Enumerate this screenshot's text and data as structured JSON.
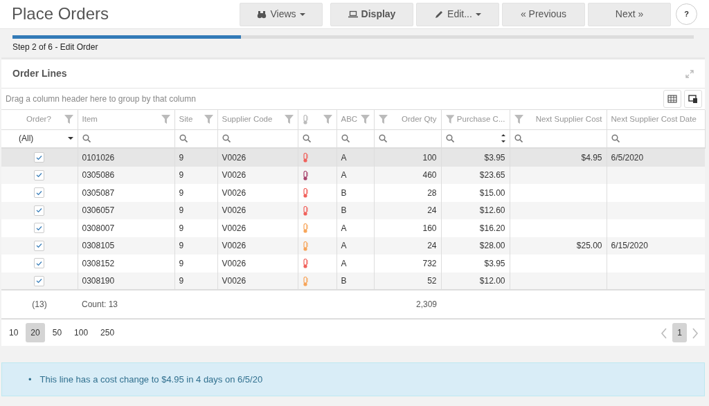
{
  "page_title": "Place Orders",
  "toolbar": [
    {
      "kind": "views",
      "label": "Views",
      "caret": true,
      "bold": false
    },
    {
      "kind": "display",
      "label": "Display",
      "caret": false,
      "bold": true
    },
    {
      "kind": "edit",
      "label": "Edit...",
      "caret": true,
      "bold": false
    },
    {
      "kind": "prev",
      "label": "« Previous",
      "caret": false,
      "bold": false
    },
    {
      "kind": "next",
      "label": "Next »",
      "caret": false,
      "bold": false
    },
    {
      "kind": "help",
      "label": "?",
      "caret": false,
      "bold": true
    }
  ],
  "progress": {
    "level": 0.335,
    "label": "Step 2 of 6 - Edit Order"
  },
  "card": {
    "title": "Order Lines",
    "group_hint": "Drag a column header here to group by that column"
  },
  "columns": [
    {
      "kind": "check",
      "label": "Order?",
      "filter_icon": true,
      "filter_value": "(All)"
    },
    {
      "kind": "text",
      "label": "Item",
      "filter_icon": true
    },
    {
      "kind": "text",
      "label": "Site",
      "filter_icon": true
    },
    {
      "kind": "text",
      "label": "Supplier Code",
      "filter_icon": true
    },
    {
      "kind": "icon",
      "filter_icon": true
    },
    {
      "kind": "text",
      "label": "ABC",
      "filter_icon": true
    },
    {
      "kind": "number",
      "label": "Order Qty",
      "filter_icon": true
    },
    {
      "kind": "text",
      "label": "Purchase C...",
      "filter_icon": true,
      "spinner": true
    },
    {
      "kind": "number",
      "label": "Next Supplier Cost",
      "filter_icon": true
    },
    {
      "kind": "text",
      "label": "Next Supplier Cost Date",
      "filter_icon": false
    }
  ],
  "rows": [
    {
      "selected": true,
      "checked": true,
      "cells": [
        "0101026",
        "9",
        "V0026",
        "A",
        "100",
        "$3.95",
        "$4.95",
        "6/5/2020"
      ],
      "color": "#f0625c"
    },
    {
      "selected": false,
      "checked": true,
      "cells": [
        "0305086",
        "9",
        "V0026",
        "A",
        "460",
        "$23.65"
      ],
      "color": "#a8456e"
    },
    {
      "selected": false,
      "checked": true,
      "cells": [
        "0305087",
        "9",
        "V0026",
        "B",
        "28",
        "$15.00"
      ],
      "color": "#f0625c"
    },
    {
      "selected": false,
      "checked": true,
      "cells": [
        "0306057",
        "9",
        "V0026",
        "B",
        "24",
        "$12.60"
      ],
      "color": "#f0625c"
    },
    {
      "selected": false,
      "checked": true,
      "cells": [
        "0308007",
        "9",
        "V0026",
        "A",
        "160",
        "$16.20"
      ],
      "color": "#f7a55a"
    },
    {
      "selected": false,
      "checked": true,
      "cells": [
        "0308105",
        "9",
        "V0026",
        "A",
        "24",
        "$28.00",
        "$25.00",
        "6/15/2020"
      ],
      "color": "#f7a55a"
    },
    {
      "selected": false,
      "checked": true,
      "cells": [
        "0308152",
        "9",
        "V0026",
        "A",
        "732",
        "$3.95"
      ],
      "color": "#f0625c"
    },
    {
      "selected": false,
      "checked": true,
      "cells": [
        "0308190",
        "9",
        "V0026",
        "B",
        "52",
        "$12.00"
      ],
      "color": "#f7a55a"
    }
  ],
  "footer": {
    "order_count": "(13)",
    "item_count": "Count: 13",
    "qty_total": "2,309"
  },
  "pager": {
    "sizes": [
      {
        "label": "10",
        "selected": false
      },
      {
        "label": "20",
        "selected": true
      },
      {
        "label": "50",
        "selected": false
      },
      {
        "label": "100",
        "selected": false
      },
      {
        "label": "250",
        "selected": false
      }
    ],
    "pages": [
      {
        "label": "1",
        "selected": true
      }
    ]
  },
  "messages": [
    {
      "bullet": "•",
      "text": "This line has a cost change to $4.95 in 4 days on 6/5/20"
    }
  ]
}
